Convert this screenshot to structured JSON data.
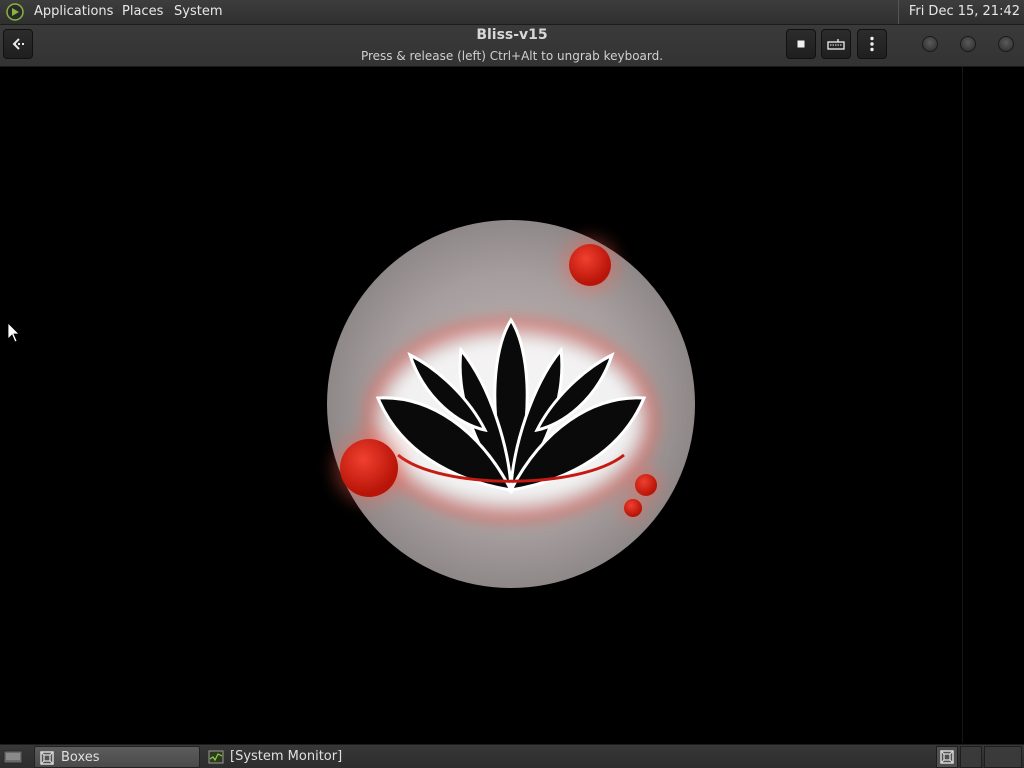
{
  "top_panel": {
    "logo_icon": "mate-logo-icon",
    "menus": [
      "Applications",
      "Places",
      "System"
    ],
    "clock": "Fri Dec 15, 21:42"
  },
  "header_bar": {
    "back_icon": "back-arrow-icon",
    "title": "Bliss-v15",
    "subtitle": "Press & release (left) Ctrl+Alt to ungrab keyboard.",
    "toolbar_icons": [
      "stop-icon",
      "keyboard-icon",
      "more-vert-icon"
    ],
    "window_controls": [
      "minimize-icon",
      "maximize-icon",
      "close-icon"
    ]
  },
  "vm_display": {
    "content": "bliss-os-boot-logo",
    "colors": {
      "disc": "#a89f9f",
      "petal": "#0a0a0a",
      "glow": "#ff4a3a",
      "bubble": "#cc1a10"
    }
  },
  "bottom_panel": {
    "show_desktop_icon": "show-desktop-icon",
    "tasks": [
      {
        "label": "Boxes",
        "icon": "boxes-icon",
        "active": true
      },
      {
        "label": "[System Monitor]",
        "icon": "system-monitor-icon",
        "active": false
      }
    ],
    "tray_icon": "boxes-icon"
  }
}
